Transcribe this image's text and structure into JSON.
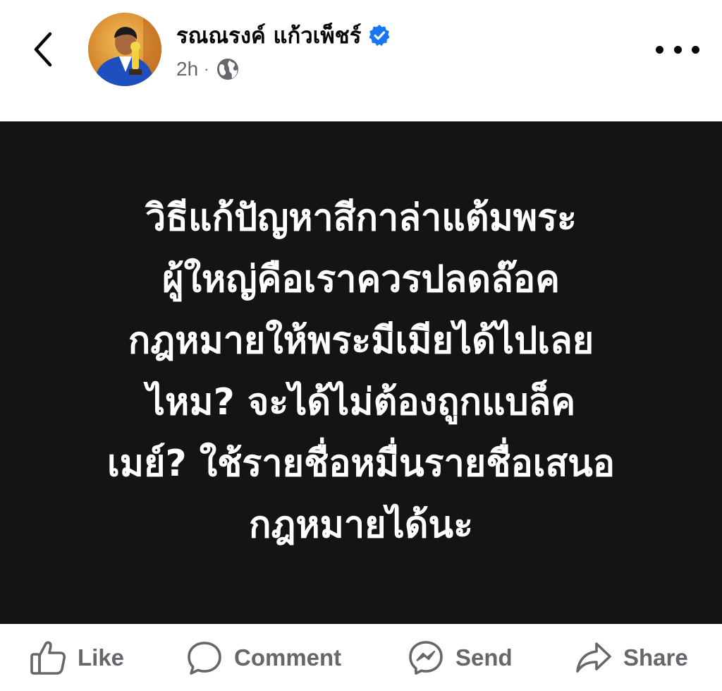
{
  "header": {
    "author_name": "รณณรงค์ แก้วเพ็ชร์",
    "timestamp": "2h",
    "separator": "·",
    "audience_icon": "globe-icon",
    "back_icon": "chevron-left-icon",
    "more_icon": "more-horizontal-icon",
    "verified_icon": "verified-badge-icon",
    "verified_color": "#1877f2"
  },
  "post": {
    "background_color": "#141414",
    "text_color": "#ffffff",
    "lines": [
      "วิธีแก้ปัญหาสีกาล่าแต้มพระ",
      "ผู้ใหญ่คือเราควรปลดล๊อค",
      "กฎหมายให้พระมีเมียได้ไปเลย",
      "ไหม? จะได้ไม่ต้องถูกแบล็ค",
      "เมย์? ใช้รายชื่อหมื่นรายชื่อเสนอ",
      "กฎหมายได้นะ"
    ]
  },
  "actions": {
    "like_label": "Like",
    "comment_label": "Comment",
    "send_label": "Send",
    "share_label": "Share",
    "color": "#65676b"
  }
}
